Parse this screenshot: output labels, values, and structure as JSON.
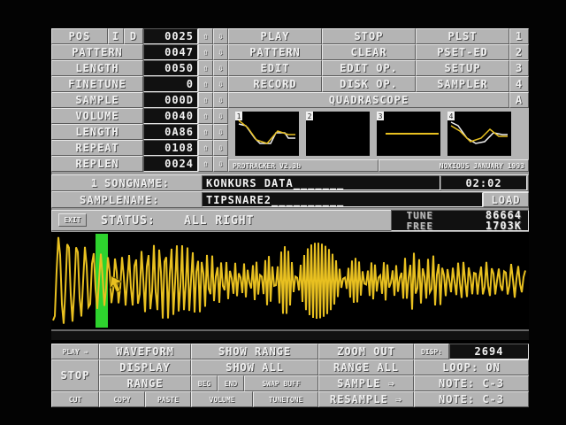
{
  "left_panel": {
    "pos": {
      "label": "POS",
      "i": "I",
      "d": "D",
      "value": "0025"
    },
    "pattern": {
      "label": "PATTERN",
      "value": "0047"
    },
    "length": {
      "label": "LENGTH",
      "value": "0050"
    },
    "finetune": {
      "label": "FINETUNE",
      "value": "0"
    },
    "sample": {
      "label": "SAMPLE",
      "value": "000D"
    },
    "volume": {
      "label": "VOLUME",
      "value": "0040"
    },
    "sample_length": {
      "label": "LENGTH",
      "value": "0A86"
    },
    "repeat": {
      "label": "REPEAT",
      "value": "0108"
    },
    "replen": {
      "label": "REPLEN",
      "value": "0024"
    },
    "up_arrow": "⇧",
    "down_arrow": "⇩"
  },
  "menu": {
    "play": "PLAY",
    "stop": "STOP",
    "plst": "PLST",
    "n1": "1",
    "pattern": "PATTERN",
    "clear": "CLEAR",
    "pset_ed": "PSET-ED",
    "n2": "2",
    "edit": "EDIT",
    "edit_op": "EDIT OP.",
    "setup": "SETUP",
    "n3": "3",
    "record": "RECORD",
    "disk_op": "DISK OP.",
    "sampler": "SAMPLER",
    "n4": "4",
    "quadrascope": "QUADRASCOPE",
    "a": "A"
  },
  "scopes": [
    {
      "num": "1"
    },
    {
      "num": "2"
    },
    {
      "num": "3"
    },
    {
      "num": "4"
    }
  ],
  "footer_credits": {
    "version": "PROTRACKER V2.3b",
    "credit": "NOXIOUS JANUARY 1993"
  },
  "song": {
    "number": "1",
    "label": "SONGNAME:",
    "name": "KONKURS DATA_______",
    "time": "02:02"
  },
  "samplename": {
    "label": "SAMPLENAME:",
    "name": "TIPSNARE2__________",
    "load": "LOAD"
  },
  "status": {
    "exit": "EXIT",
    "label": "STATUS:",
    "value": "ALL RIGHT",
    "tune_label": "TUNE",
    "tune_value": "86664",
    "free_label": "FREE",
    "free_value": "1703K"
  },
  "sampler": {
    "play": "PLAY ⇒",
    "waveform": "WAVEFORM",
    "show_range": "SHOW RANGE",
    "zoom_out": "ZOOM OUT",
    "disp_label": "DISP:",
    "disp_value": "2694",
    "stop": "STOP",
    "display": "DISPLAY",
    "show_all": "SHOW ALL",
    "range_all": "RANGE ALL",
    "loop": "LOOP: ON",
    "range": "RANGE",
    "beg": "BEG",
    "end": "END",
    "swap_buff": "SWAP BUFF",
    "sample": "SAMPLE ⇒",
    "note1": "NOTE: C-3",
    "cut": "CUT",
    "copy": "COPY",
    "paste": "PASTE",
    "volume": "VOLUME",
    "tunetone": "TUNETONE",
    "resample": "RESAMPLE ⇒",
    "note2": "NOTE: C-3"
  },
  "colors": {
    "wave": "#e8c020",
    "loop_marker": "#2ed32e",
    "panel": "#b4b4b4",
    "background": "#030303"
  }
}
